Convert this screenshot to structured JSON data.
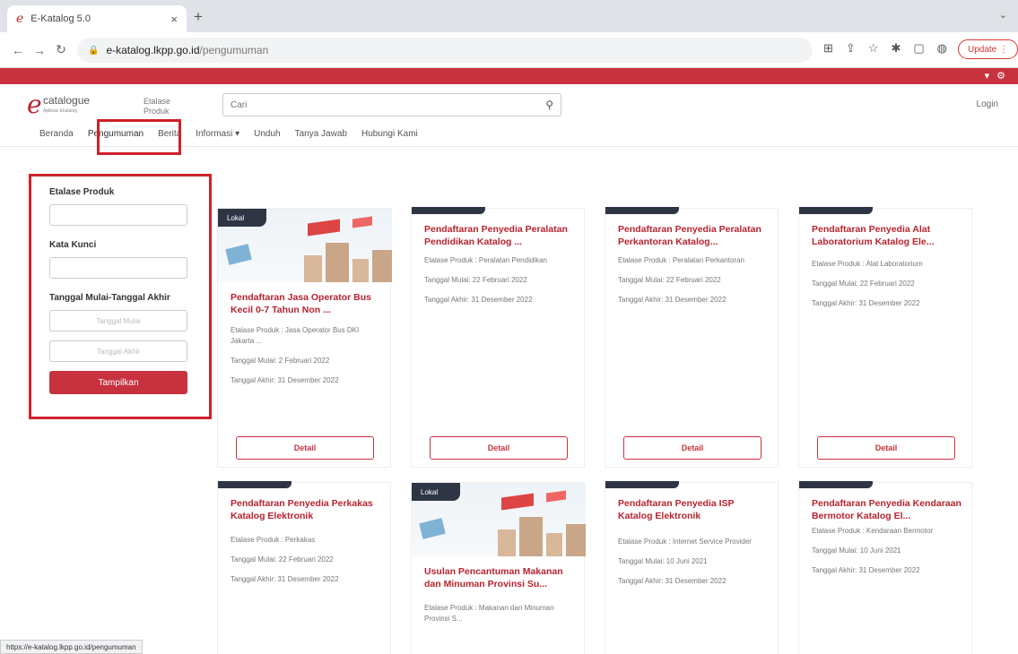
{
  "browser": {
    "tab_title": "E-Katalog 5.0",
    "url_host": "e-katalog.lkpp.go.id",
    "url_path": "/pengumuman",
    "update_label": "Update",
    "status_url": "https://e-katalog.lkpp.go.id/pengumuman"
  },
  "header": {
    "logo_word": "catalogue",
    "logo_tag": "Aplikasi Ekatalog",
    "etalase_label": "Etalase Produk",
    "search_placeholder": "Cari",
    "login": "Login"
  },
  "nav": {
    "items": [
      "Beranda",
      "Pengumuman",
      "Berita",
      "Informasi ▾",
      "Unduh",
      "Tanya Jawab",
      "Hubungi Kami"
    ]
  },
  "filter": {
    "etalase_label": "Etalase Produk",
    "kata_kunci_label": "Kata Kunci",
    "tanggal_label": "Tanggal Mulai-Tanggal Akhir",
    "tanggal_mulai_placeholder": "Tanggal Mulai",
    "tanggal_akhir_placeholder": "Tanggal Akhir",
    "button": "Tampilkan"
  },
  "card_common": {
    "lokal": "Lokal",
    "detail": "Detail"
  },
  "cards": [
    {
      "title": "Pendaftaran Jasa Operator Bus Kecil 0-7 Tahun Non ...",
      "etalase": "Etalase Produk : Jasa Operator Bus DKI Jakarta ...",
      "mulai": "Tanggal Mulai: 2 Februari 2022",
      "akhir": "Tanggal Akhir: 31 Desember 2022"
    },
    {
      "title": "Pendaftaran Penyedia Peralatan Pendidikan Katalog ...",
      "etalase": "Etalase Produk : Peralatan Pendidikan",
      "mulai": "Tanggal Mulai: 22 Februari 2022",
      "akhir": "Tanggal Akhir: 31 Desember 2022"
    },
    {
      "title": "Pendaftaran Penyedia Peralatan Perkantoran Katalog...",
      "etalase": "Etalase Produk : Peralatan Perkantoran",
      "mulai": "Tanggal Mulai: 22 Februari 2022",
      "akhir": "Tanggal Akhir: 31 Desember 2022"
    },
    {
      "title": "Pendaftaran Penyedia Alat Laboratorium Katalog Ele...",
      "etalase": "Etalase Produk : Alat Laboratorium",
      "mulai": "Tanggal Mulai: 22 Februari 2022",
      "akhir": "Tanggal Akhir: 31 Desember 2022"
    },
    {
      "title": "Pendaftaran Penyedia Perkakas Katalog Elektronik",
      "etalase": "Etalase Produk : Perkakas",
      "mulai": "Tanggal Mulai: 22 Februari 2022",
      "akhir": "Tanggal Akhir: 31 Desember 2022"
    },
    {
      "title": "Usulan Pencantuman Makanan dan Minuman Provinsi Su...",
      "etalase": "Etalase Produk : Makanan dan Minuman Provinsi S..."
    },
    {
      "title": "Pendaftaran Penyedia ISP Katalog Elektronik",
      "etalase": "Etalase Produk : Internet Service Provider",
      "mulai": "Tanggal Mulai: 10 Juni 2021",
      "akhir": "Tanggal Akhir: 31 Desember 2022"
    },
    {
      "title": "Pendaftaran Penyedia Kendaraan Bermotor Katalog El...",
      "etalase": "Etalase Produk : Kendaraan Bermotor",
      "mulai": "Tanggal Mulai: 10 Juni 2021",
      "akhir": "Tanggal Akhir: 31 Desember 2022"
    }
  ],
  "colors": {
    "brand_red": "#c8323e",
    "highlight_red": "#d0212b",
    "card_tab_dark": "#2e3645"
  }
}
